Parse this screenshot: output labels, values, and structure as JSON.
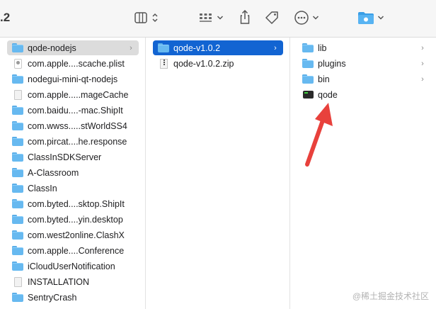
{
  "window": {
    "title_fragment": ".2"
  },
  "toolbar": {
    "icons": [
      "column-view-icon",
      "view-options-chevron-icon",
      "group-by-icon",
      "share-icon",
      "tag-icon",
      "more-actions-icon",
      "folder-action-icon"
    ],
    "accent_color": "#1264d2",
    "folder_color": "#67b9f0"
  },
  "column1": {
    "items": [
      {
        "label": "qode-nodejs",
        "icon": "folder-icon",
        "chevron": "›",
        "state": "selected-inactive"
      },
      {
        "label": "com.apple....scache.plist",
        "icon": "plist-file-icon"
      },
      {
        "label": "nodegui-mini-qt-nodejs",
        "icon": "folder-icon"
      },
      {
        "label": "com.apple.....mageCache",
        "icon": "file-icon"
      },
      {
        "label": "com.baidu....-mac.ShipIt",
        "icon": "folder-icon"
      },
      {
        "label": "com.wwss.....stWorldSS4",
        "icon": "folder-icon"
      },
      {
        "label": "com.pircat....he.response",
        "icon": "folder-icon"
      },
      {
        "label": "ClassInSDKServer",
        "icon": "folder-icon"
      },
      {
        "label": "A-Classroom",
        "icon": "folder-icon"
      },
      {
        "label": "ClassIn",
        "icon": "folder-icon"
      },
      {
        "label": "com.byted....sktop.ShipIt",
        "icon": "folder-icon"
      },
      {
        "label": "com.byted....yin.desktop",
        "icon": "folder-icon"
      },
      {
        "label": "com.west2online.ClashX",
        "icon": "folder-icon"
      },
      {
        "label": "com.apple....Conference",
        "icon": "folder-icon"
      },
      {
        "label": "iCloudUserNotification",
        "icon": "folder-icon"
      },
      {
        "label": "INSTALLATION",
        "icon": "file-icon"
      },
      {
        "label": "SentryCrash",
        "icon": "folder-icon"
      }
    ]
  },
  "column2": {
    "items": [
      {
        "label": "qode-v1.0.2",
        "icon": "folder-icon",
        "chevron": "›",
        "state": "selected-active"
      },
      {
        "label": "qode-v1.0.2.zip",
        "icon": "zip-file-icon"
      }
    ]
  },
  "column3": {
    "items": [
      {
        "label": "lib",
        "icon": "folder-icon",
        "chevron": "›"
      },
      {
        "label": "plugins",
        "icon": "folder-icon",
        "chevron": "›"
      },
      {
        "label": "bin",
        "icon": "folder-icon",
        "chevron": "›"
      },
      {
        "label": "qode",
        "icon": "executable-icon"
      }
    ]
  },
  "annotation": {
    "arrow_color": "#e8413c",
    "points_to": "qode"
  },
  "watermark": {
    "text": "@稀土掘金技术社区"
  }
}
